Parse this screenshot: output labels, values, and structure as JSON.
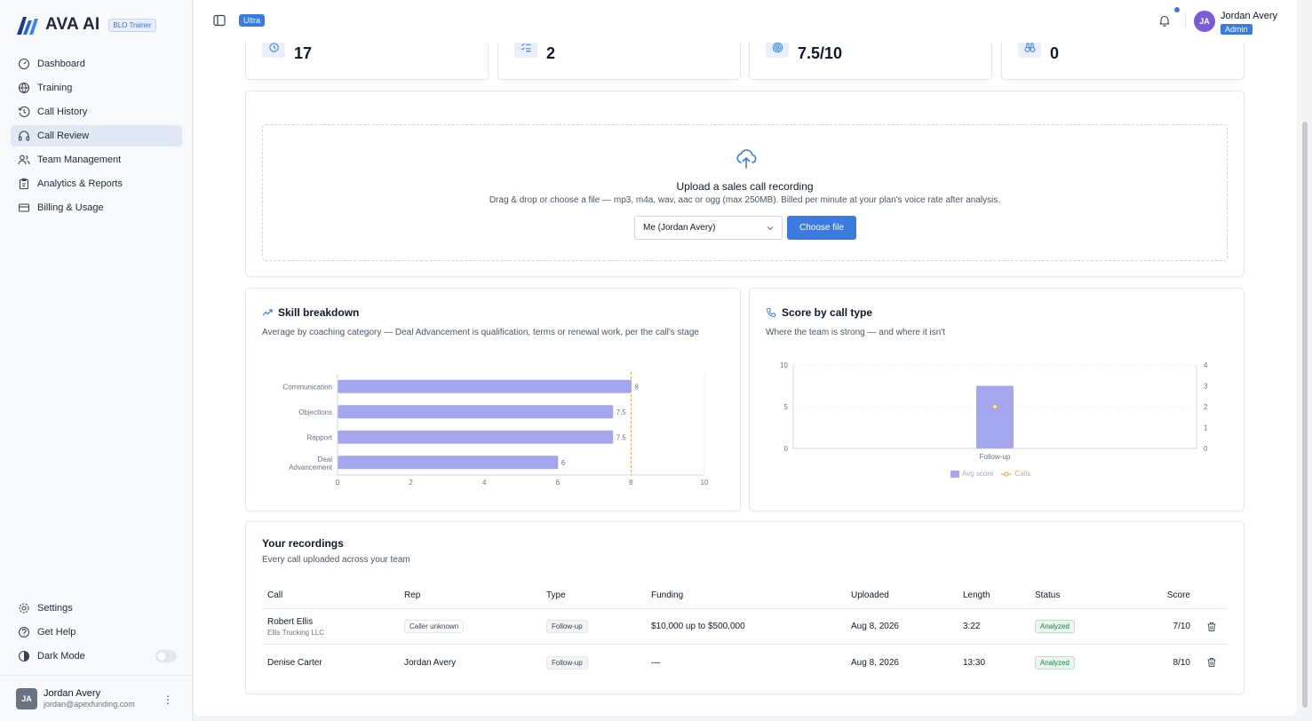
{
  "brand": {
    "name": "AVA AI",
    "badge": "BLO Trainer"
  },
  "nav": {
    "items": [
      {
        "label": "Dashboard",
        "icon": "dashboard-icon"
      },
      {
        "label": "Training",
        "icon": "training-icon"
      },
      {
        "label": "Call History",
        "icon": "history-icon"
      },
      {
        "label": "Call Review",
        "icon": "headphones-icon",
        "active": true
      },
      {
        "label": "Team Management",
        "icon": "users-icon"
      },
      {
        "label": "Analytics & Reports",
        "icon": "clipboard-icon"
      },
      {
        "label": "Billing & Usage",
        "icon": "credit-card-icon"
      }
    ],
    "bottom": [
      {
        "label": "Settings",
        "icon": "gear-icon"
      },
      {
        "label": "Get Help",
        "icon": "help-icon"
      },
      {
        "label": "Dark Mode",
        "icon": "contrast-icon"
      }
    ]
  },
  "sidebar_user": {
    "initials": "JA",
    "name": "Jordan Avery",
    "email": "jordan@apexfunding.com"
  },
  "topbar": {
    "plan": "Ultra",
    "user_initials": "JA",
    "user_name": "Jordan Avery",
    "role": "Admin"
  },
  "stats": [
    {
      "value": "17",
      "icon": "clock-icon"
    },
    {
      "value": "2",
      "icon": "checklist-icon"
    },
    {
      "value": "7.5/10",
      "icon": "target-icon"
    },
    {
      "value": "0",
      "icon": "binoculars-icon"
    }
  ],
  "upload": {
    "title": "Upload a sales call recording",
    "subtitle": "Drag & drop or choose a file — mp3, m4a, wav, aac or ogg (max 250MB). Billed per minute at your plan's voice rate after analysis.",
    "rep_selected": "Me (Jordan Avery)",
    "button": "Choose file"
  },
  "skill_card": {
    "title": "Skill breakdown",
    "subtitle": "Average by coaching category — Deal Advancement is qualification, terms or renewal work, per the call's stage"
  },
  "calltype_card": {
    "title": "Score by call type",
    "subtitle": "Where the team is strong — and where it isn't"
  },
  "chart_data": [
    {
      "type": "bar",
      "orientation": "horizontal",
      "categories": [
        "Communication",
        "Objections",
        "Rapport",
        "Deal Advancement"
      ],
      "values": [
        8,
        7.5,
        7.5,
        6
      ],
      "xlim": [
        0,
        10
      ],
      "xticks": [
        "0",
        "2",
        "4",
        "6",
        "8",
        "10"
      ],
      "reference_line": 8,
      "color": "#a5a7ee",
      "reference_color": "#f5a142"
    },
    {
      "type": "bar",
      "categories": [
        "Follow-up"
      ],
      "series": [
        {
          "name": "Avg score",
          "values": [
            7.5
          ],
          "axis": "left",
          "color": "#a5a7ee"
        },
        {
          "name": "Calls",
          "values": [
            2
          ],
          "axis": "right",
          "type": "line",
          "color": "#f5a142"
        }
      ],
      "ylim_left": [
        0,
        10
      ],
      "yticks_left": [
        "0",
        "5",
        "10"
      ],
      "ylim_right": [
        0,
        4
      ],
      "yticks_right": [
        "0",
        "1",
        "2",
        "3",
        "4"
      ]
    }
  ],
  "recordings": {
    "title": "Your recordings",
    "subtitle": "Every call uploaded across your team",
    "columns": [
      "Call",
      "Rep",
      "Type",
      "Funding",
      "Uploaded",
      "Length",
      "Status",
      "Score"
    ],
    "rows": [
      {
        "name": "Robert Ellis",
        "company": "Ellis Trucking LLC",
        "rep": "Caller unknown",
        "rep_chip": true,
        "type": "Follow-up",
        "funding": "$10,000 up to $500,000",
        "uploaded": "Aug 8, 2026",
        "length": "3:22",
        "status": "Analyzed",
        "score": "7/10"
      },
      {
        "name": "Denise Carter",
        "company": "",
        "rep": "Jordan Avery",
        "rep_chip": false,
        "type": "Follow-up",
        "funding": "—",
        "uploaded": "Aug 8, 2026",
        "length": "13:30",
        "status": "Analyzed",
        "score": "8/10"
      }
    ]
  }
}
